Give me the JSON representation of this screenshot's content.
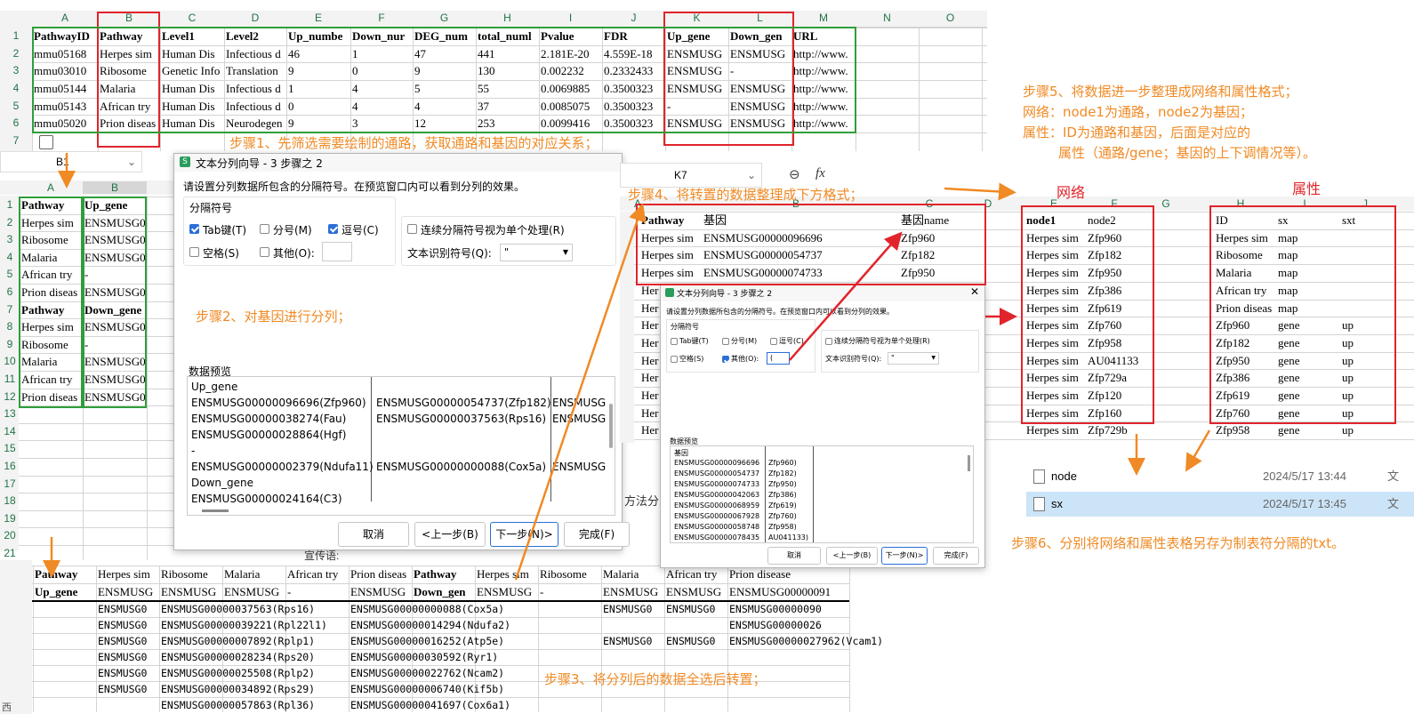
{
  "sheet1": {
    "col_headers": [
      "A",
      "B",
      "C",
      "D",
      "E",
      "F",
      "G",
      "H",
      "I",
      "J",
      "K",
      "L",
      "M",
      "N",
      "O"
    ],
    "row_numbers": [
      "1",
      "2",
      "3",
      "4",
      "5",
      "6",
      "7"
    ],
    "header": [
      "PathwayID",
      "Pathway",
      "Level1",
      "Level2",
      "Up_numbe",
      "Down_nur",
      "DEG_num",
      "total_numl",
      "Pvalue",
      "FDR",
      "Up_gene",
      "Down_gen",
      "URL"
    ],
    "rows": [
      [
        "mmu05168",
        "Herpes sim",
        "Human Dis",
        "Infectious d",
        "46",
        "1",
        "47",
        "441",
        "2.181E-20",
        "4.559E-18",
        "ENSMUSG",
        "ENSMUSG",
        "http://www."
      ],
      [
        "mmu03010",
        "Ribosome",
        "Genetic Info",
        "Translation",
        "9",
        "0",
        "9",
        "130",
        "0.002232",
        "0.2332433",
        "ENSMUSG",
        "-",
        "http://www."
      ],
      [
        "mmu05144",
        "Malaria",
        "Human Dis",
        "Infectious d",
        "1",
        "4",
        "5",
        "55",
        "0.0069885",
        "0.3500323",
        "ENSMUSG",
        "ENSMUSG",
        "http://www."
      ],
      [
        "mmu05143",
        "African try",
        "Human Dis",
        "Infectious d",
        "0",
        "4",
        "4",
        "37",
        "0.0085075",
        "0.3500323",
        "-",
        "ENSMUSG",
        "http://www."
      ],
      [
        "mmu05020",
        "Prion diseas",
        "Human Dis",
        "Neurodegen",
        "9",
        "3",
        "12",
        "253",
        "0.0099416",
        "0.3500323",
        "ENSMUSG",
        "ENSMUSG",
        "http://www."
      ]
    ]
  },
  "steps": {
    "s1": "步骤1、先筛选需要绘制的通路，获取通路和基因的对应关系；",
    "s2": "步骤2、对基因进行分列；",
    "s3": "步骤3、将分列后的数据全选后转置；",
    "s4": "步骤4、将转置的数据整理成下方格式；",
    "s5_l1": "步骤5、将数据进一步整理成网络和属性格式；",
    "s5_l2": "网络：node1为通路，node2为基因；",
    "s5_l3": "属性：ID为通路和基因，后面是对应的",
    "s5_l4": "属性（通路/gene；基因的上下调情况等）。",
    "s6": "步骤6、分别将网络和属性表格另存为制表符分隔的txt。"
  },
  "sheet2": {
    "cellref": "B1",
    "col_headers": [
      "A",
      "B"
    ],
    "row_numbers": [
      "1",
      "2",
      "3",
      "4",
      "5",
      "6",
      "7",
      "8",
      "9",
      "10",
      "11",
      "12",
      "13",
      "14",
      "15",
      "16",
      "17",
      "18",
      "19",
      "20",
      "21"
    ],
    "rows": [
      [
        "Pathway",
        "Up_gene"
      ],
      [
        "Herpes sim",
        "ENSMUSG0000"
      ],
      [
        "Ribosome",
        "ENSMUSG0000"
      ],
      [
        "Malaria",
        "ENSMUSG0000"
      ],
      [
        "African try",
        "-"
      ],
      [
        "Prion diseas",
        "ENSMUSG0000"
      ],
      [
        "Pathway",
        "Down_gene"
      ],
      [
        "Herpes sim",
        "ENSMUSG0000"
      ],
      [
        "Ribosome",
        "-"
      ],
      [
        "Malaria",
        "ENSMUSG0000"
      ],
      [
        "African try",
        "ENSMUSG0000"
      ],
      [
        "Prion diseas",
        "ENSMUSG0000"
      ]
    ]
  },
  "dialog1": {
    "title": "文本分列向导 - 3 步骤之 2",
    "desc": "请设置分列数据所包含的分隔符号。在预览窗口内可以看到分列的效果。",
    "group_label": "分隔符号",
    "opt_tab": "Tab键(T)",
    "opt_semicolon": "分号(M)",
    "opt_comma": "逗号(C)",
    "opt_space": "空格(S)",
    "opt_other": "其他(O):",
    "opt_consecutive": "连续分隔符号视为单个处理(R)",
    "qualifier_label": "文本识别符号(Q):",
    "qualifier_value": "\"",
    "preview_label": "数据预览",
    "preview_rows": [
      [
        "Up_gene",
        "",
        ""
      ],
      [
        "ENSMUSG00000096696(Zfp960)",
        "ENSMUSG00000054737(Zfp182)",
        "ENSMUSG"
      ],
      [
        "ENSMUSG00000038274(Fau)",
        "ENSMUSG00000037563(Rps16)",
        "ENSMUSG"
      ],
      [
        "ENSMUSG00000028864(Hgf)",
        "",
        ""
      ],
      [
        "-",
        "",
        ""
      ],
      [
        "ENSMUSG00000002379(Ndufa11)",
        "ENSMUSG00000000088(Cox5a)",
        "ENSMUSG"
      ],
      [
        "Down_gene",
        "",
        ""
      ],
      [
        "ENSMUSG00000024164(C3)",
        "",
        ""
      ]
    ],
    "cancel": "取消",
    "back": "<上一步(B)",
    "next": "下一步(N)>",
    "finish": "完成(F)"
  },
  "sheet3": {
    "row1": [
      "Pathway",
      "Herpes sim",
      "Ribosome",
      "Malaria",
      "African try",
      "Prion diseas",
      "Pathway",
      "Herpes sim",
      "Ribosome",
      "Malaria",
      "African try",
      "Prion disease"
    ],
    "row2": [
      "Up_gene",
      "ENSMUSG",
      "ENSMUSG",
      "ENSMUSG",
      "-",
      "ENSMUSG",
      "Down_gen",
      "ENSMUSG",
      "-",
      "ENSMUSG",
      "ENSMUSG",
      "ENSMUSG00000091"
    ],
    "rows_mono": [
      [
        "ENSMUSG0",
        "ENSMUSG00000037563(Rps16)",
        "ENSMUSG00000000088(Cox5a)",
        "ENSMUSG0",
        "ENSMUSG0",
        "ENSMUSG00000090"
      ],
      [
        "ENSMUSG0",
        "ENSMUSG00000039221(Rpl22l1)",
        "ENSMUSG00000014294(Ndufa2)",
        "",
        "",
        "ENSMUSG00000026"
      ],
      [
        "ENSMUSG0",
        "ENSMUSG00000007892(Rplp1)",
        "ENSMUSG00000016252(Atp5e)",
        "ENSMUSG0",
        "ENSMUSG0",
        "ENSMUSG00000027962(Vcam1)"
      ],
      [
        "ENSMUSG0",
        "ENSMUSG00000028234(Rps20)",
        "ENSMUSG00000030592(Ryr1)",
        "",
        "",
        ""
      ],
      [
        "ENSMUSG0",
        "ENSMUSG00000025508(Rplp2)",
        "ENSMUSG00000022762(Ncam2)",
        "",
        "",
        ""
      ],
      [
        "ENSMUSG0",
        "ENSMUSG00000034892(Rps29)",
        "ENSMUSG00000006740(Kif5b)",
        "",
        "",
        ""
      ]
    ],
    "bottom_fragment": "ENSMUSG00000057863(Rpl36)",
    "bottom_fragment2": "ENSMUSG00000041697(Cox6a1)"
  },
  "sheet4": {
    "cellref": "K7",
    "fx": "fx",
    "col_headers": [
      "A",
      "B",
      "C",
      "D",
      "E",
      "F",
      "G",
      "H",
      "I",
      "J"
    ],
    "rows_left": [
      [
        "Pathway",
        "基因",
        "基因name"
      ],
      [
        "Herpes sim",
        "ENSMUSG00000096696",
        "Zfp960"
      ],
      [
        "Herpes sim",
        "ENSMUSG00000054737",
        "Zfp182"
      ],
      [
        "Herpes sim",
        "ENSMUSG00000074733",
        "Zfp950"
      ]
    ],
    "row_stub": "Her",
    "network_label": "网络",
    "attr_label": "属性",
    "network_rows": [
      [
        "node1",
        "node2"
      ],
      [
        "Herpes sim",
        "Zfp960"
      ],
      [
        "Herpes sim",
        "Zfp182"
      ],
      [
        "Herpes sim",
        "Zfp950"
      ],
      [
        "Herpes sim",
        "Zfp386"
      ],
      [
        "Herpes sim",
        "Zfp619"
      ],
      [
        "Herpes sim",
        "Zfp760"
      ],
      [
        "Herpes sim",
        "Zfp958"
      ],
      [
        "Herpes sim",
        "AU041133"
      ],
      [
        "Herpes sim",
        "Zfp729a"
      ],
      [
        "Herpes sim",
        "Zfp120"
      ],
      [
        "Herpes sim",
        "Zfp160"
      ],
      [
        "Herpes sim",
        "Zfp729b"
      ]
    ],
    "attr_rows": [
      [
        "ID",
        "sx",
        "sxt"
      ],
      [
        "Herpes sim",
        "map",
        ""
      ],
      [
        "Ribosome",
        "map",
        ""
      ],
      [
        "Malaria",
        "map",
        ""
      ],
      [
        "African try",
        "map",
        ""
      ],
      [
        "Prion diseas",
        "map",
        ""
      ],
      [
        "Zfp960",
        "gene",
        "up"
      ],
      [
        "Zfp182",
        "gene",
        "up"
      ],
      [
        "Zfp950",
        "gene",
        "up"
      ],
      [
        "Zfp386",
        "gene",
        "up"
      ],
      [
        "Zfp619",
        "gene",
        "up"
      ],
      [
        "Zfp760",
        "gene",
        "up"
      ],
      [
        "Zfp958",
        "gene",
        "up"
      ]
    ]
  },
  "dialog2": {
    "title": "文本分列向导 - 3 步骤之 2",
    "desc": "请设置分列数据所包含的分隔符号。在预览窗口内可以看到分列的效果。",
    "group_label": "分隔符号",
    "opt_tab": "Tab键(T)",
    "opt_semicolon": "分号(M)",
    "opt_comma": "逗号(C)",
    "opt_space": "空格(S)",
    "opt_other": "其他(O):",
    "other_value": "(",
    "opt_consecutive": "连续分隔符号视为单个处理(R)",
    "qualifier_label": "文本识别符号(Q):",
    "qualifier_value": "\"",
    "preview_label": "数据预览",
    "preview_header": "基因",
    "preview_rows": [
      [
        "ENSMUSG00000096696",
        "Zfp960)"
      ],
      [
        "ENSMUSG00000054737",
        "Zfp182)"
      ],
      [
        "ENSMUSG00000074733",
        "Zfp950)"
      ],
      [
        "ENSMUSG00000042063",
        "Zfp386)"
      ],
      [
        "ENSMUSG00000068959",
        "Zfp619)"
      ],
      [
        "ENSMUSG00000067928",
        "Zfp760)"
      ],
      [
        "ENSMUSG00000058748",
        "Zfp958)"
      ],
      [
        "ENSMUSG00000078435",
        "AU041133)"
      ]
    ],
    "cancel": "取消",
    "back": "<上一步(B)",
    "next": "下一步(N)>",
    "finish": "完成(F)"
  },
  "files": [
    {
      "name": "node",
      "date": "2024/5/17 13:44",
      "type": "文"
    },
    {
      "name": "sx",
      "date": "2024/5/17 13:45",
      "type": "文"
    }
  ],
  "misc": {
    "fragment_method": "方法分",
    "fragment_promo": "宣传语: ",
    "corner_text": "西"
  }
}
